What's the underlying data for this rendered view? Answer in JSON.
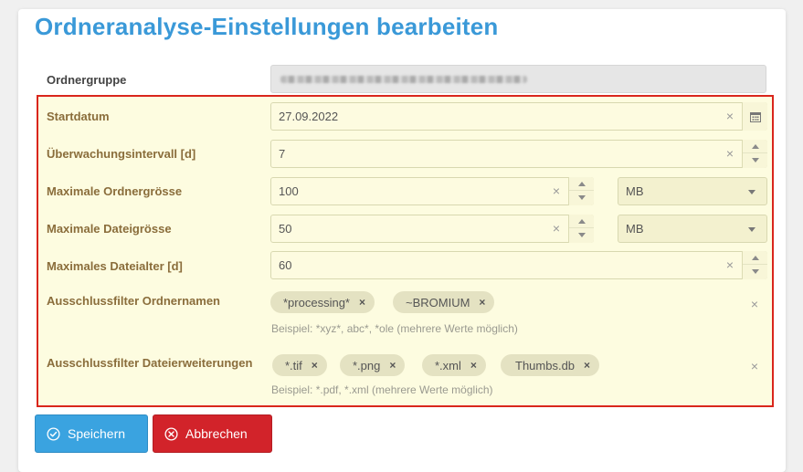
{
  "title": "Ordneranalyse-Einstellungen bearbeiten",
  "folder_group": {
    "label": "Ordnergruppe"
  },
  "start_date": {
    "label": "Startdatum",
    "value": "27.09.2022"
  },
  "monitoring_interval": {
    "label": "Überwachungsintervall [d]",
    "value": "7"
  },
  "max_folder_size": {
    "label": "Maximale Ordnergrösse",
    "value": "100",
    "unit": "MB"
  },
  "max_file_size": {
    "label": "Maximale Dateigrösse",
    "value": "50",
    "unit": "MB"
  },
  "max_file_age": {
    "label": "Maximales Dateialter [d]",
    "value": "60"
  },
  "folder_filter": {
    "label": "Ausschlussfilter Ordnernamen",
    "tags": [
      "*processing*",
      "~BROMIUM"
    ],
    "hint": "Beispiel: *xyz*, abc*, *ole (mehrere Werte möglich)"
  },
  "extension_filter": {
    "label": "Ausschlussfilter Dateierweiterungen",
    "tags": [
      "*.tif",
      "*.png",
      "*.xml",
      "Thumbs.db"
    ],
    "hint": "Beispiel: *.pdf, *.xml (mehrere Werte möglich)"
  },
  "buttons": {
    "save": "Speichern",
    "cancel": "Abbrechen"
  },
  "icons": {
    "clear": "×",
    "tag_remove": "×"
  },
  "colors": {
    "title": "#3a99d8",
    "highlight_border": "#d9261c",
    "save": "#3aa3e0",
    "cancel": "#d2232a"
  }
}
